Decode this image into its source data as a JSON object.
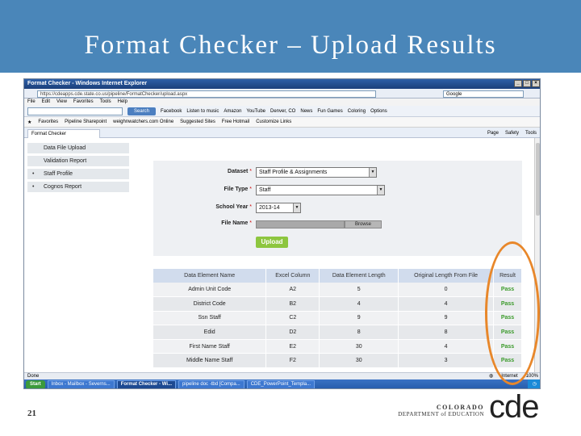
{
  "slide": {
    "title": "Format Checker – Upload Results",
    "number": "21"
  },
  "browser": {
    "window_title": "Format Checker - Windows Internet Explorer",
    "address": "https://cdeapps.cde.state.co.us/pipeline/FormatChecker/upload.aspx",
    "search_placeholder": "Google",
    "menu": [
      "File",
      "Edit",
      "View",
      "Favorites",
      "Tools",
      "Help"
    ],
    "toolbar": {
      "search_button": "Search",
      "items": [
        "Facebook",
        "Listen to music",
        "Amazon",
        "YouTube",
        "Denver, CO",
        "News",
        "Fun Games",
        "Coloring",
        "Options"
      ]
    },
    "favorites": {
      "label": "Favorites",
      "items": [
        "Pipeline Sharepoint",
        "weighnwatchers.com Online",
        "Suggested Sites",
        "Free Hotmail",
        "Customize Links"
      ]
    },
    "tab_label": "Format Checker",
    "command_bar": [
      "Page",
      "Safety",
      "Tools"
    ],
    "status": {
      "left": "Done",
      "zone": "Internet",
      "zoom": "100%"
    },
    "taskbar": {
      "start": "Start",
      "items": [
        "Inbox - Mailbox - Severns...",
        "Format Checker - Wi...",
        "pipeline doc -tbd [Compa...",
        "CDE_PowerPoint_Templa..."
      ],
      "active_index": 1
    }
  },
  "nav": {
    "items": [
      {
        "label": "Data File Upload",
        "bullet": false
      },
      {
        "label": "Validation Report",
        "bullet": false
      },
      {
        "label": "Staff Profile",
        "bullet": true
      },
      {
        "label": "Cognos Report",
        "bullet": true
      }
    ]
  },
  "form": {
    "dataset": {
      "label": "Dataset",
      "value": "Staff Profile & Assignments"
    },
    "file_type": {
      "label": "File Type",
      "value": "Staff"
    },
    "school_year": {
      "label": "School Year",
      "value": "2013-14"
    },
    "file_name": {
      "label": "File Name",
      "browse": "Browse"
    },
    "required_mark": "*",
    "upload_button": "Upload"
  },
  "results": {
    "headers": [
      "Data Element Name",
      "Excel Column",
      "Data Element Length",
      "Original Length From File",
      "Result"
    ],
    "rows": [
      [
        "Admin Unit Code",
        "A2",
        "5",
        "0",
        "Pass"
      ],
      [
        "District Code",
        "B2",
        "4",
        "4",
        "Pass"
      ],
      [
        "Ssn Staff",
        "C2",
        "9",
        "9",
        "Pass"
      ],
      [
        "Edid",
        "D2",
        "8",
        "8",
        "Pass"
      ],
      [
        "First Name Staff",
        "E2",
        "30",
        "4",
        "Pass"
      ],
      [
        "Middle Name Staff",
        "F2",
        "30",
        "3",
        "Pass"
      ]
    ]
  },
  "logo": {
    "line1": "COLORADO",
    "line2": "DEPARTMENT of EDUCATION",
    "mark": "cde"
  },
  "colors": {
    "header_blue": "#4a86b9",
    "pass_green": "#3a9a2a",
    "upload_green": "#8dc63f",
    "highlight_orange": "#e8872a"
  }
}
